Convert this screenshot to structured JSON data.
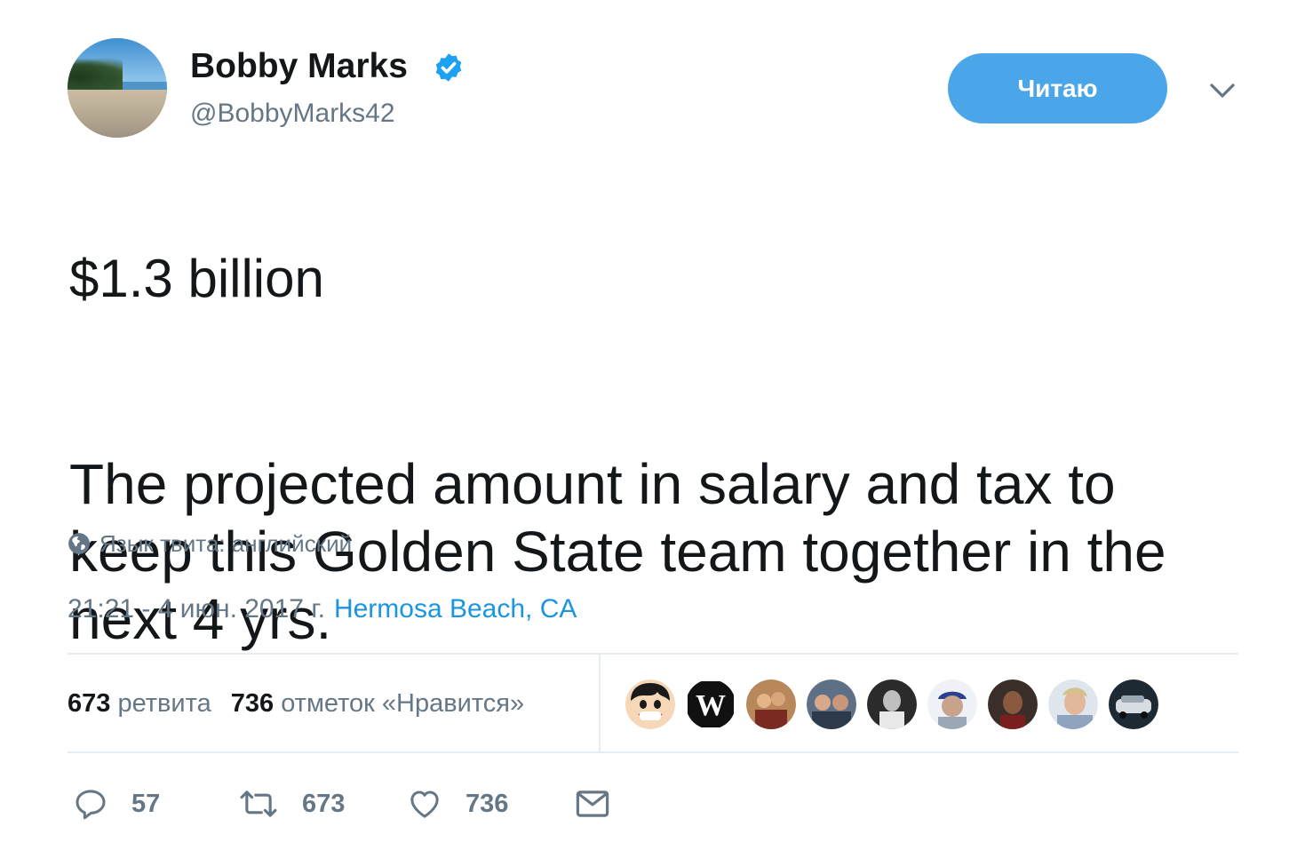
{
  "author": {
    "name": "Bobby Marks",
    "handle": "@BobbyMarks42",
    "verified": true
  },
  "follow_button": {
    "label": "Читаю"
  },
  "tweet": {
    "line1": "$1.3 billion",
    "line2": "The projected amount in salary and tax to keep this Golden State team together in the next 4 yrs."
  },
  "language_note": "Язык твита: английский",
  "meta": {
    "datetime": "21:21 - 4 июн. 2017 г.",
    "location": "Hermosa Beach, CA"
  },
  "stats": {
    "retweets_count": "673",
    "retweets_label": "ретвита",
    "likes_count": "736",
    "likes_label": "отметок «Нравится»"
  },
  "actions": {
    "reply_count": "57",
    "retweet_count": "673",
    "like_count": "736"
  },
  "likers": [
    {
      "name": "liker-1-avatar"
    },
    {
      "name": "liker-2-avatar"
    },
    {
      "name": "liker-3-avatar"
    },
    {
      "name": "liker-4-avatar"
    },
    {
      "name": "liker-5-avatar"
    },
    {
      "name": "liker-6-avatar"
    },
    {
      "name": "liker-7-avatar"
    },
    {
      "name": "liker-8-avatar"
    },
    {
      "name": "liker-9-avatar"
    }
  ],
  "colors": {
    "accent": "#1b95e0",
    "follow_button_bg": "#4aa6e8",
    "verified_badge": "#1da1f2",
    "muted_text": "#657786"
  }
}
